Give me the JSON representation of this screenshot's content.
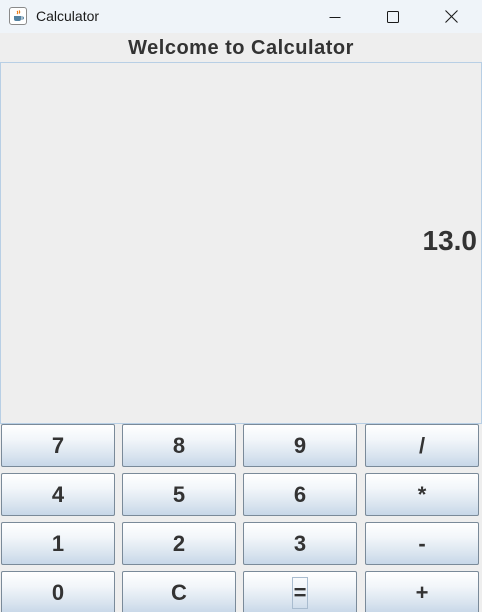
{
  "window": {
    "title": "Calculator",
    "icon": "java-cup-icon"
  },
  "header": {
    "title": "Welcome to Calculator"
  },
  "display": {
    "value": "13.0"
  },
  "keypad": {
    "keys": [
      [
        "7",
        "8",
        "9",
        "/"
      ],
      [
        "4",
        "5",
        "6",
        "*"
      ],
      [
        "1",
        "2",
        "3",
        "-"
      ],
      [
        "0",
        "C",
        "=",
        "+"
      ]
    ],
    "focused_key": "="
  },
  "colors": {
    "titlebar": "#eff4f9",
    "background": "#eeeeee",
    "text": "#333333",
    "display_border": "#b8cfe5",
    "key_gradient_bottom": "#c7d7e8"
  }
}
